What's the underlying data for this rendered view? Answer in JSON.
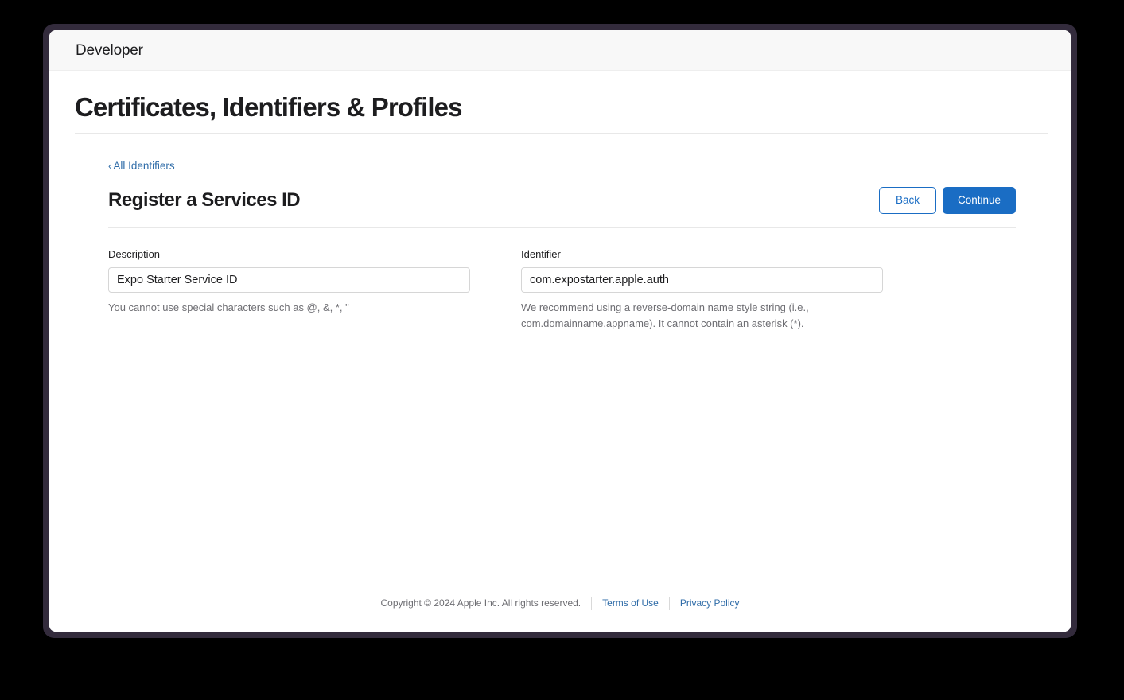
{
  "window": {
    "frame_color": "#332b3c",
    "background": "#000000"
  },
  "topbar": {
    "apple_glyph": "",
    "brand_word": "Developer"
  },
  "header": {
    "page_title": "Certificates, Identifiers & Profiles"
  },
  "breadcrumb": {
    "chevron": "‹",
    "label": "All Identifiers"
  },
  "section": {
    "title": "Register a Services ID",
    "back_label": "Back",
    "continue_label": "Continue",
    "accent_color": "#1a6dc4",
    "link_color": "#2f6ca8"
  },
  "form": {
    "description": {
      "label": "Description",
      "value": "Expo Starter Service ID",
      "placeholder": "",
      "help": "You cannot use special characters such as @, &, *, \""
    },
    "identifier": {
      "label": "Identifier",
      "value": "com.expostarter.apple.auth",
      "placeholder": "",
      "help": "We recommend using a reverse-domain name style string (i.e., com.domainname.appname). It cannot contain an asterisk (*)."
    }
  },
  "footer": {
    "copyright": "Copyright © 2024 Apple Inc. All rights reserved.",
    "terms_label": "Terms of Use",
    "privacy_label": "Privacy Policy"
  }
}
